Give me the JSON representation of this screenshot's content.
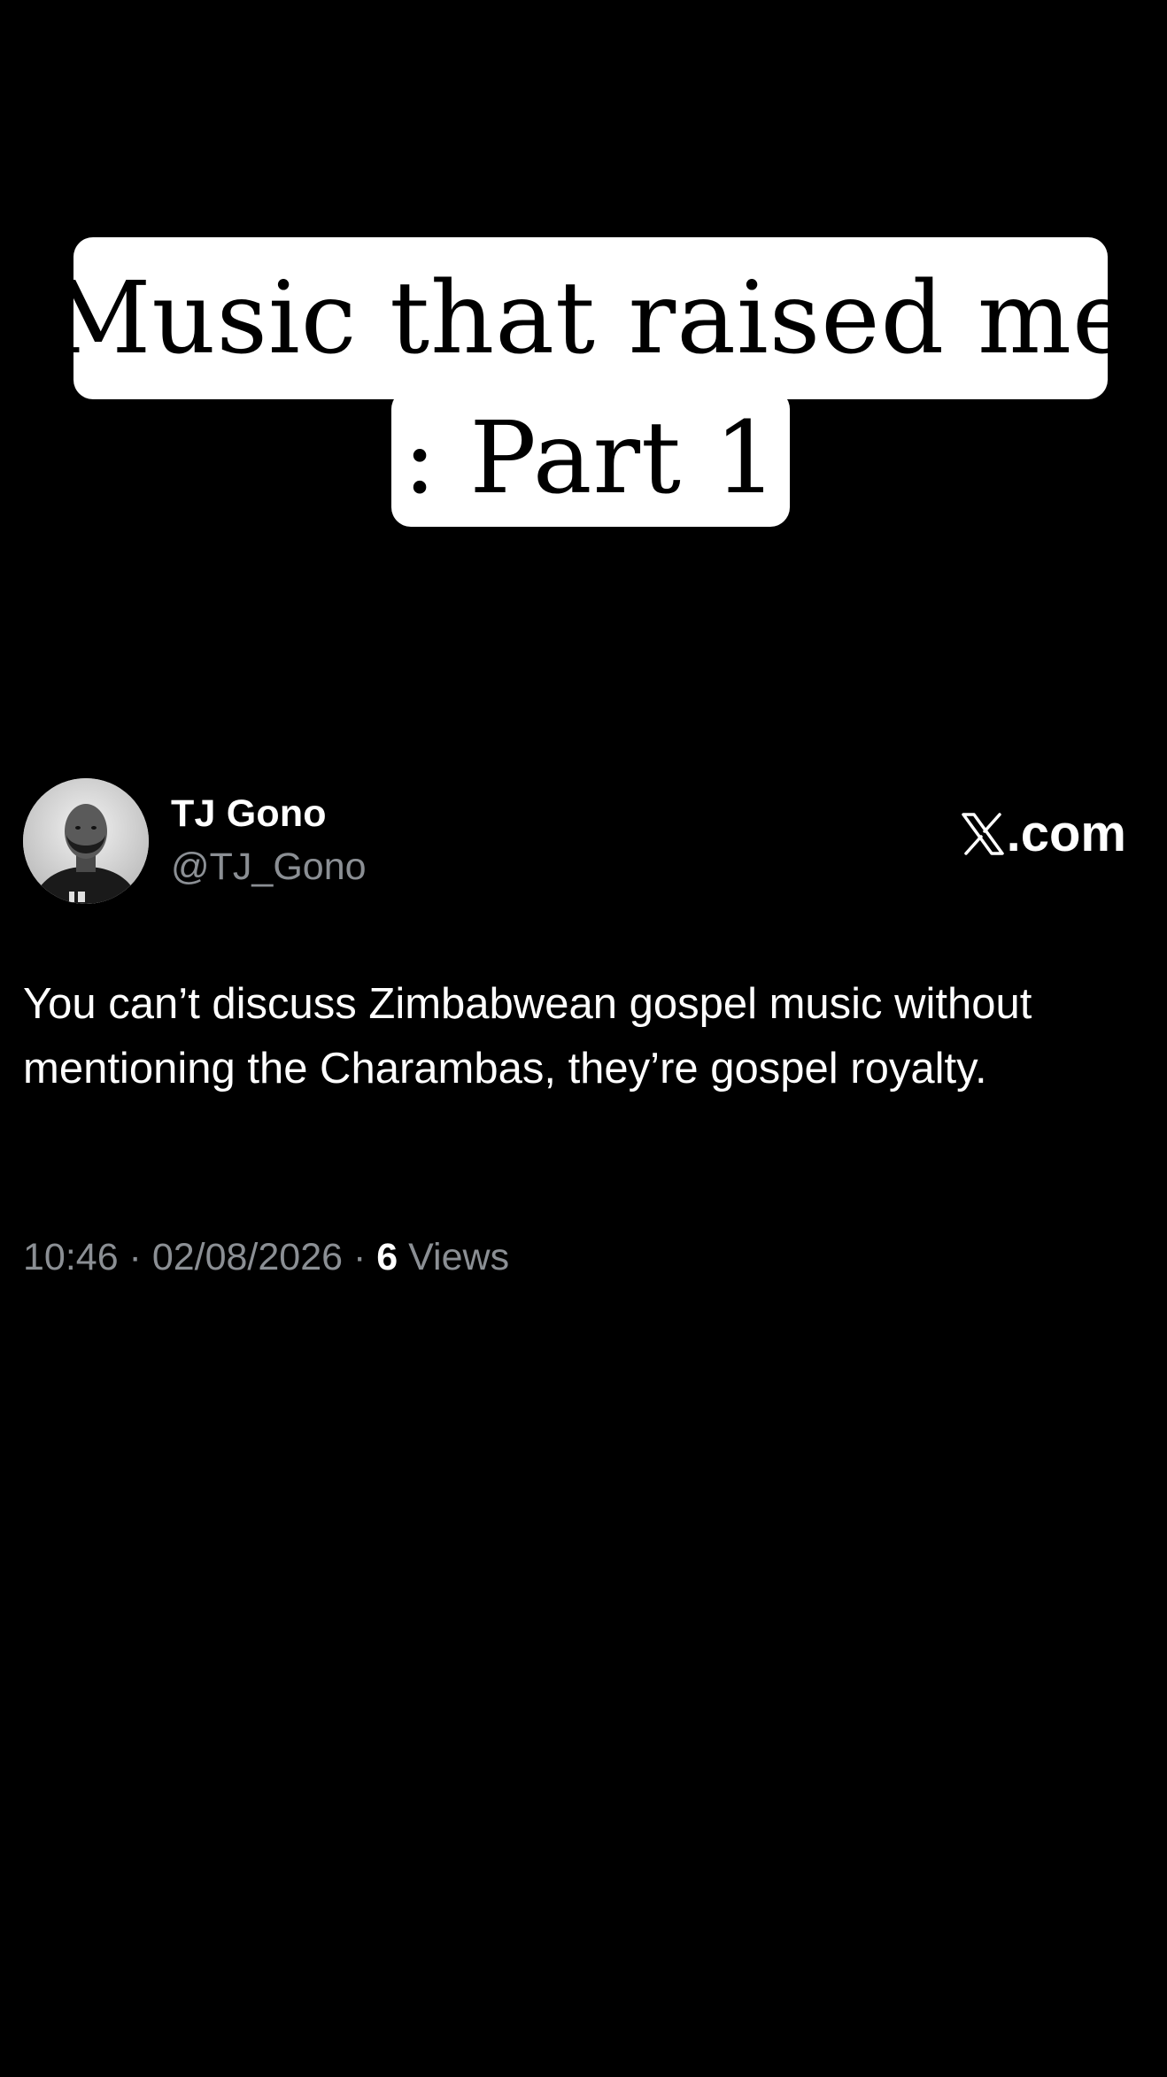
{
  "caption": {
    "line1": "Music that raised me",
    "line2": ": Part 1"
  },
  "tweet": {
    "author_name": "TJ Gono",
    "author_handle": "@TJ_Gono",
    "site_label": ".com",
    "site_icon": "x-logo-icon",
    "body": "You can’t discuss Zimbabwean gospel music without mentioning the Charambas, they’re gospel royalty.",
    "time": "10:46",
    "date": "02/08/2026",
    "separator": " · ",
    "views_count": "6",
    "views_label": "Views"
  },
  "colors": {
    "background": "#000000",
    "caption_bg": "#ffffff",
    "text_primary": "#ffffff",
    "text_secondary": "#8b8f94"
  }
}
